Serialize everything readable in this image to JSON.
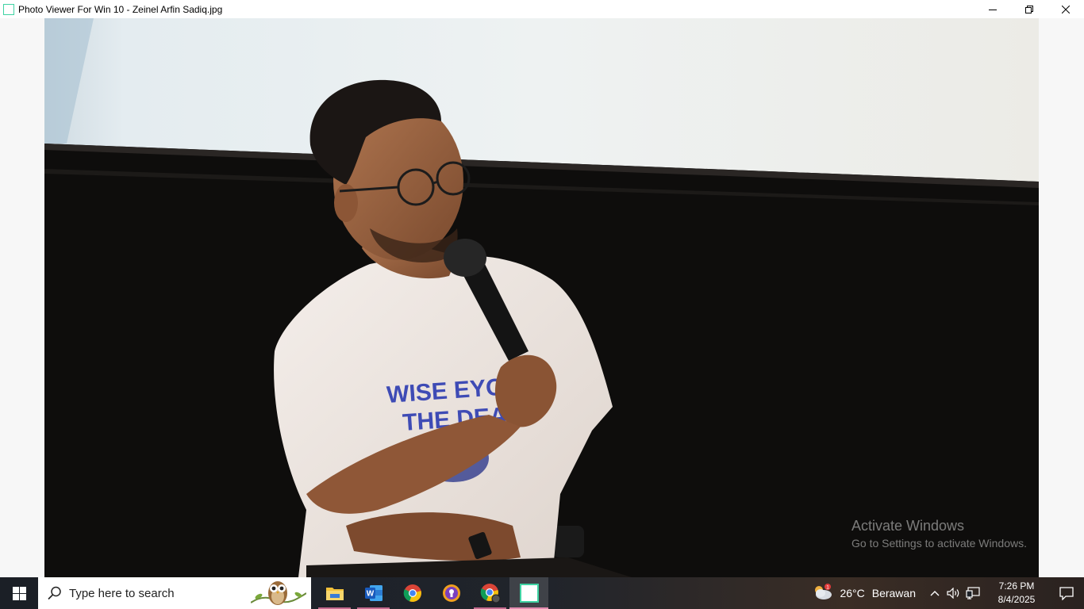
{
  "window": {
    "title": "Photo Viewer For Win 10 - Zeinel Arfin Sadiq.jpg",
    "controls": {
      "minimize": "minimize-icon",
      "restore": "restore-icon",
      "close": "close-icon"
    }
  },
  "photo": {
    "shirt_text_line1": "WISE EYON",
    "shirt_text_line2": "THE DEAM"
  },
  "watermark": {
    "title": "Activate Windows",
    "subtitle": "Go to Settings to activate Windows."
  },
  "taskbar": {
    "search_placeholder": "Type here to search",
    "apps": [
      {
        "name": "file-explorer-icon"
      },
      {
        "name": "word-icon"
      },
      {
        "name": "chrome-icon"
      },
      {
        "name": "browser-icon"
      },
      {
        "name": "chrome-profile-icon"
      },
      {
        "name": "photo-viewer-icon"
      }
    ],
    "weather": {
      "temp": "26°C",
      "condition": "Berawan",
      "badge": "1"
    },
    "clock": {
      "time": "7:26 PM",
      "date": "8/4/2025"
    }
  },
  "colors": {
    "accent_underline": "#e48bb0",
    "app_icon_border": "#3fd3a3"
  }
}
